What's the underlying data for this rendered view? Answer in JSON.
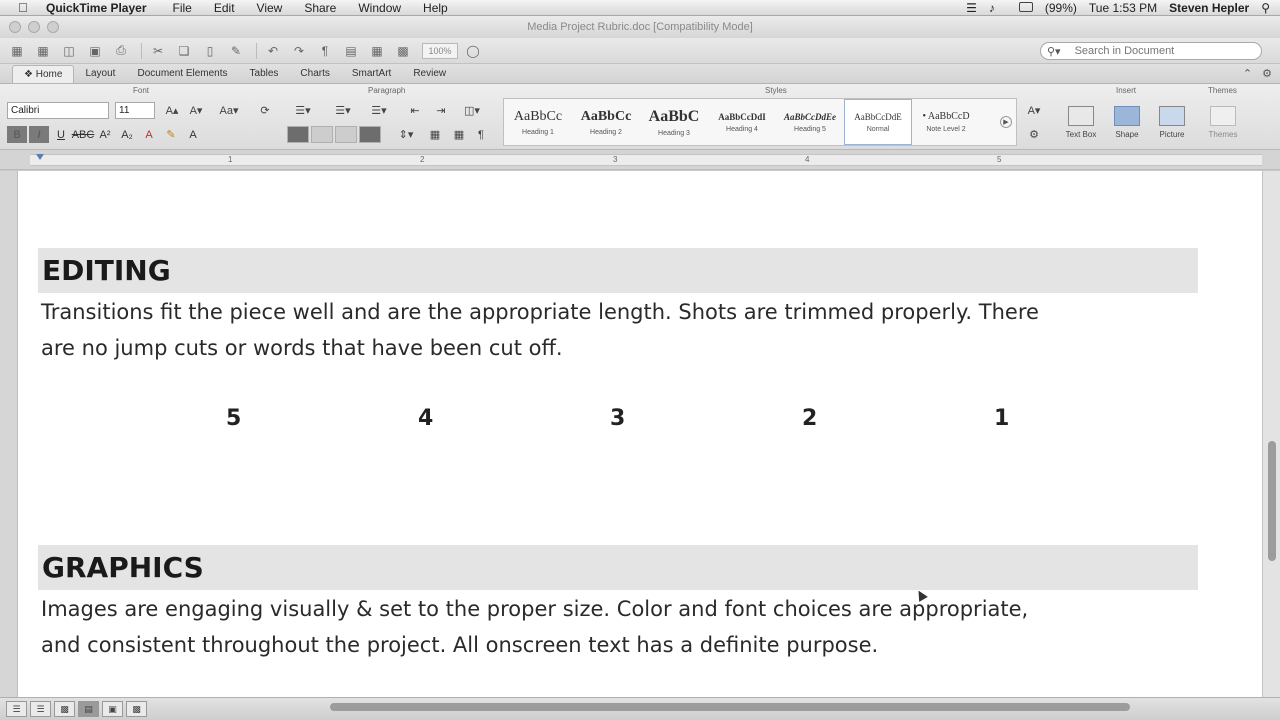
{
  "menubar": {
    "app_name": "QuickTime Player",
    "items": [
      "File",
      "Edit",
      "View",
      "Share",
      "Window",
      "Help"
    ],
    "clock": "Tue 1:53 PM",
    "user": "Steven Hepler",
    "battery": "(99%)"
  },
  "window": {
    "title": "Media Project Rubric.doc [Compatibility Mode]"
  },
  "toolbar": {
    "zoom": "100%",
    "search_placeholder": "Search in Document"
  },
  "ribbon": {
    "tabs": [
      "Home",
      "Layout",
      "Document Elements",
      "Tables",
      "Charts",
      "SmartArt",
      "Review"
    ],
    "active_tab": "Home",
    "groups": {
      "font": "Font",
      "paragraph": "Paragraph",
      "styles": "Styles",
      "insert": "Insert",
      "themes": "Themes"
    },
    "font_name": "Calibri",
    "font_size": "11",
    "styles": [
      {
        "sample": "AaBbCc",
        "name": "Heading 1"
      },
      {
        "sample": "AaBbCc",
        "name": "Heading 2"
      },
      {
        "sample": "AaBbC",
        "name": "Heading 3"
      },
      {
        "sample": "AaBbCcDdI",
        "name": "Heading 4"
      },
      {
        "sample": "AaBbCcDdEe",
        "name": "Heading 5"
      },
      {
        "sample": "AaBbCcDdE",
        "name": "Normal"
      },
      {
        "sample": "• AaBbCcD",
        "name": "Note Level 2"
      }
    ],
    "insert_items": [
      "Text Box",
      "Shape",
      "Picture"
    ],
    "themes_label": "Themes"
  },
  "ruler": {
    "numbers": [
      "1",
      "2",
      "3",
      "4",
      "5"
    ]
  },
  "document": {
    "section1": {
      "heading": "EDITING",
      "body_line1": "Transitions fit the piece well and are the appropriate length.  Shots are trimmed properly.  There",
      "body_line2": "are no jump cuts or words that have been cut off."
    },
    "scores": [
      "5",
      "4",
      "3",
      "2",
      "1"
    ],
    "section2": {
      "heading": "GRAPHICS",
      "body_line1": "Images are engaging visually & set to the proper size.  Color and font choices are appropriate,",
      "body_line2": "and consistent throughout the project.  All onscreen text has a definite purpose."
    }
  }
}
